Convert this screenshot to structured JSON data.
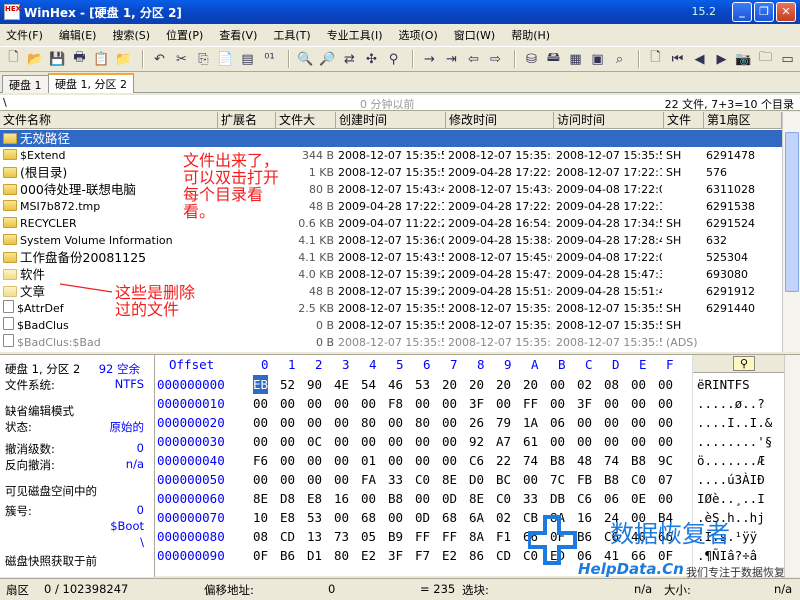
{
  "window": {
    "title": "WinHex - [硬盘 1, 分区 2]",
    "version": "15.2",
    "min_label": "_",
    "max_label": "❐",
    "close_label": "✕"
  },
  "menu": [
    "文件(F)",
    "编辑(E)",
    "搜索(S)",
    "位置(P)",
    "查看(V)",
    "工具(T)",
    "专业工具(I)",
    "选项(O)",
    "窗口(W)",
    "帮助(H)"
  ],
  "tabs": [
    "硬盘 1",
    "硬盘 1, 分区 2"
  ],
  "pathbar": {
    "path": "\\",
    "center": "0 分钟以前",
    "count": "22 文件, 7+3=10 个目录"
  },
  "columns": [
    "文件名称",
    "扩展名",
    "文件大",
    "创建时间",
    "修改时间",
    "访问时间",
    "文件",
    "第1扇区"
  ],
  "files": [
    {
      "name": "无效路径",
      "size": "",
      "created": "",
      "modified": "",
      "accessed": "",
      "attr": "",
      "sector": "",
      "icon": "folder",
      "selected": true
    },
    {
      "name": "$Extend",
      "size": "344 B",
      "created": "2008-12-07  15:35:58",
      "modified": "2008-12-07  15:35:58",
      "accessed": "2008-12-07  15:35:58",
      "attr": "SH",
      "sector": "6291478",
      "icon": "folder"
    },
    {
      "name": "(根目录)",
      "size": "1 KB",
      "created": "2008-12-07  15:35:58",
      "modified": "2009-04-28  17:22:13",
      "accessed": "2008-12-07  17:22:13",
      "attr": "SH",
      "sector": "576",
      "icon": "folder"
    },
    {
      "name": "000待处理-联想电脑",
      "size": "80 B",
      "created": "2008-12-07  15:43:46",
      "modified": "2008-12-07  15:43:46",
      "accessed": "2009-04-08  17:22:06",
      "attr": "",
      "sector": "6311028",
      "icon": "folder"
    },
    {
      "name": "MSI7b872.tmp",
      "size": "48 B",
      "created": "2009-04-28  17:22:13",
      "modified": "2009-04-28  17:22:13",
      "accessed": "2009-04-28  17:22:13",
      "attr": "",
      "sector": "6291538",
      "icon": "folder"
    },
    {
      "name": "RECYCLER",
      "size": "0.6 KB",
      "created": "2009-04-07  11:22:28",
      "modified": "2009-04-28  16:54:55",
      "accessed": "2009-04-28  17:34:56",
      "attr": "SH",
      "sector": "6291524",
      "icon": "folder"
    },
    {
      "name": "System Volume Information",
      "size": "4.1 KB",
      "created": "2008-12-07  15:36:01",
      "modified": "2009-04-28  15:38:47",
      "accessed": "2009-04-28  17:28:48",
      "attr": "SH",
      "sector": "632",
      "icon": "folder"
    },
    {
      "name": "工作盘备份20081125",
      "size": "4.1 KB",
      "created": "2008-12-07  15:43:53",
      "modified": "2008-12-07  15:45:04",
      "accessed": "2009-04-08  17:22:06",
      "attr": "",
      "sector": "525304",
      "icon": "folder"
    },
    {
      "name": "软件",
      "size": "4.0 KB",
      "created": "2008-12-07  15:39:24",
      "modified": "2009-04-28  15:47:33",
      "accessed": "2009-04-28  15:47:33",
      "attr": "",
      "sector": "693080",
      "icon": "deleted"
    },
    {
      "name": "文章",
      "size": "48 B",
      "created": "2008-12-07  15:39:29",
      "modified": "2009-04-28  15:51:49",
      "accessed": "2009-04-28  15:51:49",
      "attr": "",
      "sector": "6291912",
      "icon": "deleted"
    },
    {
      "name": "$AttrDef",
      "size": "2.5 KB",
      "created": "2008-12-07  15:35:58",
      "modified": "2008-12-07  15:35:58",
      "accessed": "2008-12-07  15:35:58",
      "attr": "SH",
      "sector": "6291440",
      "icon": "file"
    },
    {
      "name": "$BadClus",
      "size": "0 B",
      "created": "2008-12-07  15:35:58",
      "modified": "2008-12-07  15:35:58",
      "accessed": "2008-12-07  15:35:58",
      "attr": "SH",
      "sector": "",
      "icon": "file"
    },
    {
      "name": "$BadClus:$Bad",
      "size": "0 B",
      "created": "2008-12-07  15:35:58",
      "modified": "2008-12-07  15:35:58",
      "accessed": "2008-12-07  15:35:58",
      "attr": "(ADS)",
      "sector": "",
      "icon": "file",
      "gray": true
    }
  ],
  "annotations": {
    "top": [
      "文件出来了，",
      "可以双击打开",
      "每个目录看",
      "看。"
    ],
    "bottom": [
      "这些是删除",
      "过的文件"
    ]
  },
  "info": {
    "disk": "硬盘 1, 分区 2",
    "free": "92 空余",
    "fs_label": "文件系统:",
    "fs": "NTFS",
    "mode_label": "缺省编辑模式",
    "state_label": "状态:",
    "state": "原始的",
    "undo_level_label": "撤消级数:",
    "undo_level": "0",
    "undo_rev_label": "反向撤消:",
    "undo_rev": "n/a",
    "visible_label": "可见磁盘空间中的",
    "cluster_label": "簇号:",
    "cluster": "0",
    "boot": "$Boot",
    "backslash": "\\",
    "snapshot_label": "磁盘快照获取于前"
  },
  "hex": {
    "header_offset": "Offset",
    "cols": [
      "0",
      "1",
      "2",
      "3",
      "4",
      "5",
      "6",
      "7",
      "8",
      "9",
      "A",
      "B",
      "C",
      "D",
      "E",
      "F"
    ],
    "rows": [
      {
        "off": "000000000",
        "bytes": [
          "EB",
          "52",
          "90",
          "4E",
          "54",
          "46",
          "53",
          "20",
          "20",
          "20",
          "20",
          "00",
          "02",
          "08",
          "00",
          "00"
        ],
        "ascii": "ëRINTFS"
      },
      {
        "off": "000000010",
        "bytes": [
          "00",
          "00",
          "00",
          "00",
          "00",
          "F8",
          "00",
          "00",
          "3F",
          "00",
          "FF",
          "00",
          "3F",
          "00",
          "00",
          "00"
        ],
        "ascii": ".....ø..?"
      },
      {
        "off": "000000020",
        "bytes": [
          "00",
          "00",
          "00",
          "00",
          "80",
          "00",
          "80",
          "00",
          "26",
          "79",
          "1A",
          "06",
          "00",
          "00",
          "00",
          "00"
        ],
        "ascii": "....I..I.&"
      },
      {
        "off": "000000030",
        "bytes": [
          "00",
          "00",
          "0C",
          "00",
          "00",
          "00",
          "00",
          "00",
          "92",
          "A7",
          "61",
          "00",
          "00",
          "00",
          "00",
          "00"
        ],
        "ascii": "........'§"
      },
      {
        "off": "000000040",
        "bytes": [
          "F6",
          "00",
          "00",
          "00",
          "01",
          "00",
          "00",
          "00",
          "C6",
          "22",
          "74",
          "B8",
          "48",
          "74",
          "B8",
          "9C"
        ],
        "ascii": "ö.......Æ"
      },
      {
        "off": "000000050",
        "bytes": [
          "00",
          "00",
          "00",
          "00",
          "FA",
          "33",
          "C0",
          "8E",
          "D0",
          "BC",
          "00",
          "7C",
          "FB",
          "B8",
          "C0",
          "07"
        ],
        "ascii": "....ú3ÀIÐ"
      },
      {
        "off": "000000060",
        "bytes": [
          "8E",
          "D8",
          "E8",
          "16",
          "00",
          "B8",
          "00",
          "0D",
          "8E",
          "C0",
          "33",
          "DB",
          "C6",
          "06",
          "0E",
          "00"
        ],
        "ascii": "IØè..¸..I"
      },
      {
        "off": "000000070",
        "bytes": [
          "10",
          "E8",
          "53",
          "00",
          "68",
          "00",
          "0D",
          "68",
          "6A",
          "02",
          "CB",
          "8A",
          "16",
          "24",
          "00",
          "B4"
        ],
        "ascii": ".èS.h..hj"
      },
      {
        "off": "000000080",
        "bytes": [
          "08",
          "CD",
          "13",
          "73",
          "05",
          "B9",
          "FF",
          "FF",
          "8A",
          "F1",
          "66",
          "0F",
          "B6",
          "C6",
          "40",
          "66"
        ],
        "ascii": ".Í.s.¹ÿÿ"
      },
      {
        "off": "000000090",
        "bytes": [
          "0F",
          "B6",
          "D1",
          "80",
          "E2",
          "3F",
          "F7",
          "E2",
          "86",
          "CD",
          "C0",
          "ED",
          "06",
          "41",
          "66",
          "0F"
        ],
        "ascii": ".¶ÑIâ?÷â"
      }
    ]
  },
  "status": {
    "sector_label": "扇区",
    "sector": "0 / 102398247",
    "offset_label": "偏移地址:",
    "offset": "0",
    "eq": "= 235",
    "select_label": "选块:",
    "na1": "n/a",
    "size_label": "大小:",
    "na2": "n/a"
  },
  "watermark": {
    "cn": "数据恢复者",
    "url": "HelpData.Cn",
    "slogan": "我们专注于数据恢复"
  },
  "colors": {
    "title": "#0a4fd8",
    "selection": "#316ac5",
    "annotation": "#f02020",
    "offset": "#0000ff"
  }
}
